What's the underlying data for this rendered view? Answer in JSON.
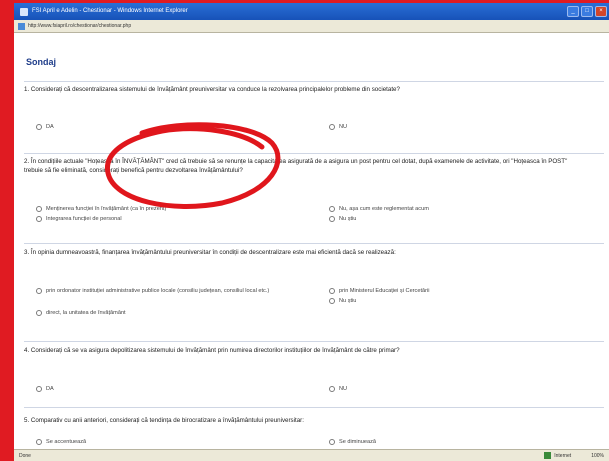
{
  "window": {
    "title": "FSI April e Adelin - Chestionar - Windows Internet Explorer",
    "url": "http://www.fsiapril.ro/chestionar/chestionar.php"
  },
  "page": {
    "title": "Sondaj"
  },
  "questions": [
    {
      "text": "1. Considerați că descentralizarea sistemului de învățământ preuniversitar va conduce la rezolvarea principalelor probleme din societate?",
      "options": [
        "DA",
        "NU"
      ]
    },
    {
      "text": "2. În condițiile actuale \"Hoțeasca în ÎNVĂȚĂMÂNT\" cred că trebuie să se renunțe la capacitatea asigurată de a asigura un post pentru cel dotat, după examenele de activitate, ori \"Hoțeasca în POST\" trebuie să fie eliminată, considerați benefică pentru dezvoltarea învățământului?",
      "options": [
        "Menținerea funcției în învățământ (ca în prezent)",
        "Integrarea funcției de personal",
        "Nu, așa cum este reglementat acum",
        "Nu știu"
      ]
    },
    {
      "text": "3. În opinia dumneavoastră, finanțarea învățământului preuniversitar în condiții de descentralizare este mai eficientă dacă se realizează:",
      "options": [
        "prin ordonator instituției administrative publice locale (consiliu județean, consiliul local etc.)",
        "direct, la unitatea de învățământ",
        "prin Ministerul Educației și Cercetării",
        "Nu știu"
      ]
    },
    {
      "text": "4. Considerați că se va asigura depolitizarea sistemului de învățământ prin numirea directorilor instituțiilor de învățământ de către primar?",
      "options": [
        "DA",
        "NU"
      ]
    },
    {
      "text": "5. Comparativ cu anii anteriori, considerați că tendința de birocratizare a învățământului preuniversitar:",
      "options": [
        "Se accentuează",
        "Se diminuează"
      ]
    }
  ],
  "statusbar": {
    "status": "Done",
    "zone": "Internet",
    "zoom": "100%"
  },
  "colors": {
    "frame": "#e01b22",
    "title_bar": "#1f5fc8",
    "annotation": "#e0161c"
  }
}
